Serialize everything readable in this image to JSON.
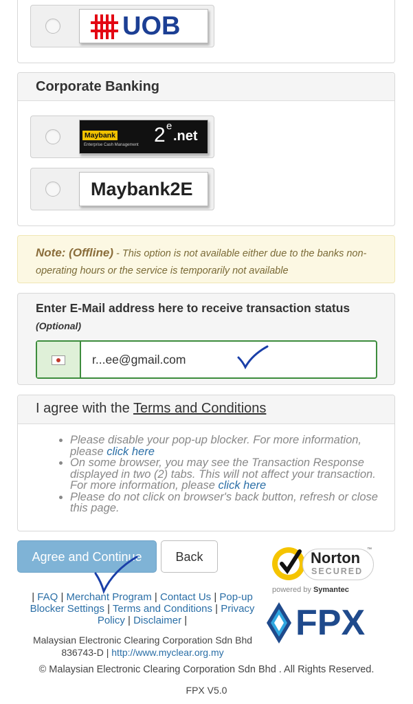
{
  "retail_banking": {
    "banks": [
      {
        "name": "UOB",
        "logo_text": "UOB"
      }
    ]
  },
  "corporate_banking": {
    "title": "Corporate Banking",
    "banks": [
      {
        "logo_brand": "Maybank",
        "logo_suffix_a": "2",
        "logo_suffix_e": "e",
        "logo_suffix_net": ".net",
        "logo_tagline": "Enterprise Cash Management"
      },
      {
        "logo_text": "Maybank2E"
      }
    ]
  },
  "note": {
    "label": "Note: (Offline)",
    "dash": " - ",
    "text": "This option is not available either due to the banks non-operating hours or the service is temporarily not available"
  },
  "email": {
    "title": "Enter E-Mail address here to receive transaction status",
    "optional": "(Optional)",
    "value": "r...ee@gmail.com"
  },
  "terms": {
    "title_prefix": "I agree with the ",
    "title_link": "Terms and Conditions",
    "items": [
      {
        "text": "Please disable your pop-up blocker. For more information, please ",
        "link": "click here"
      },
      {
        "text": "On some browser, you may see the Transaction Response displayed in two (2) tabs. This will not affect your transaction. For more information, please ",
        "link": "click here"
      },
      {
        "text": "Please do not click on browser's back button, refresh or close this page.",
        "link": ""
      }
    ]
  },
  "buttons": {
    "agree": "Agree and Continue",
    "back": "Back"
  },
  "footer": {
    "links": [
      "FAQ",
      "Merchant Program",
      "Contact Us",
      "Pop-up Blocker Settings",
      "Terms and Conditions",
      "Privacy Policy",
      "Disclaimer"
    ],
    "company_line1": "Malaysian Electronic Clearing Corporation Sdn Bhd",
    "company_reg": "836743-D",
    "company_url": "http://www.myclear.org.my",
    "copyright": "© Malaysian Electronic Clearing Corporation Sdn Bhd . All Rights Reserved.",
    "version": "FPX V5.0"
  },
  "badges": {
    "norton_title": "Norton",
    "norton_secured": "SECURED",
    "norton_tm": "™",
    "powered_by": "powered by",
    "symantec": "Symantec",
    "fpx": "FPX"
  },
  "colors": {
    "link": "#2a6ea6",
    "button_primary": "#7fb3d6",
    "note_bg": "#fcf8e3",
    "uob_red": "#e30613",
    "uob_blue": "#1c3f94",
    "fpx_blue": "#1f4a8c",
    "annotation_blue": "#1a3fa8"
  }
}
